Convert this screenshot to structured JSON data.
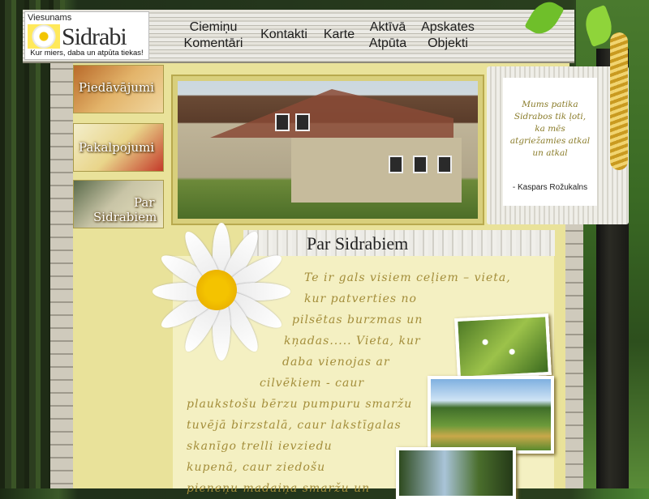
{
  "logo": {
    "top_label": "Viesunams",
    "name": "Sidrabi",
    "tagline": "Kur miers, daba un atpūta tiekas!"
  },
  "nav": [
    {
      "line1": "Ciemiņu",
      "line2": "Komentāri"
    },
    {
      "line1": "Kontakti",
      "line2": ""
    },
    {
      "line1": "Karte",
      "line2": ""
    },
    {
      "line1": "Aktīvā",
      "line2": "Atpūta"
    },
    {
      "line1": "Apskates",
      "line2": "Objekti"
    }
  ],
  "side_tabs": [
    {
      "line1": "Piedāvājumi",
      "line2": ""
    },
    {
      "line1": "Pakalpojumi",
      "line2": ""
    },
    {
      "line1": "Par",
      "line2": "Sidrabiem"
    }
  ],
  "quote": {
    "lines": [
      "Mums patika",
      "Sidrabos tik ļoti,",
      "ka mēs",
      "atgriežamies atkal",
      "un atkal"
    ],
    "author": "- Kaspars Rožukalns"
  },
  "section": {
    "title": "Par Sidrabiem",
    "lines": [
      "Te ir gals visiem ceļiem – vieta,",
      "kur patverties no",
      "pilsētas burzmas un",
      "kņadas..... Vieta, kur",
      "daba vienojas ar",
      "cilvēkiem - caur",
      "plaukstošu bērzu pumpuru smaržu",
      "tuvējā birzstalā, caur lakstīgalas",
      "skanīgo trelli ievziedu",
      "kupenā, caur ziedošu",
      "pieneņu madaiņa smaržu un"
    ]
  },
  "colors": {
    "content_bg": "#e9e29a",
    "text_gold": "#a38d3a"
  },
  "icons": {
    "logo_flower": "daisy-icon",
    "decor": "daisy-icon"
  }
}
